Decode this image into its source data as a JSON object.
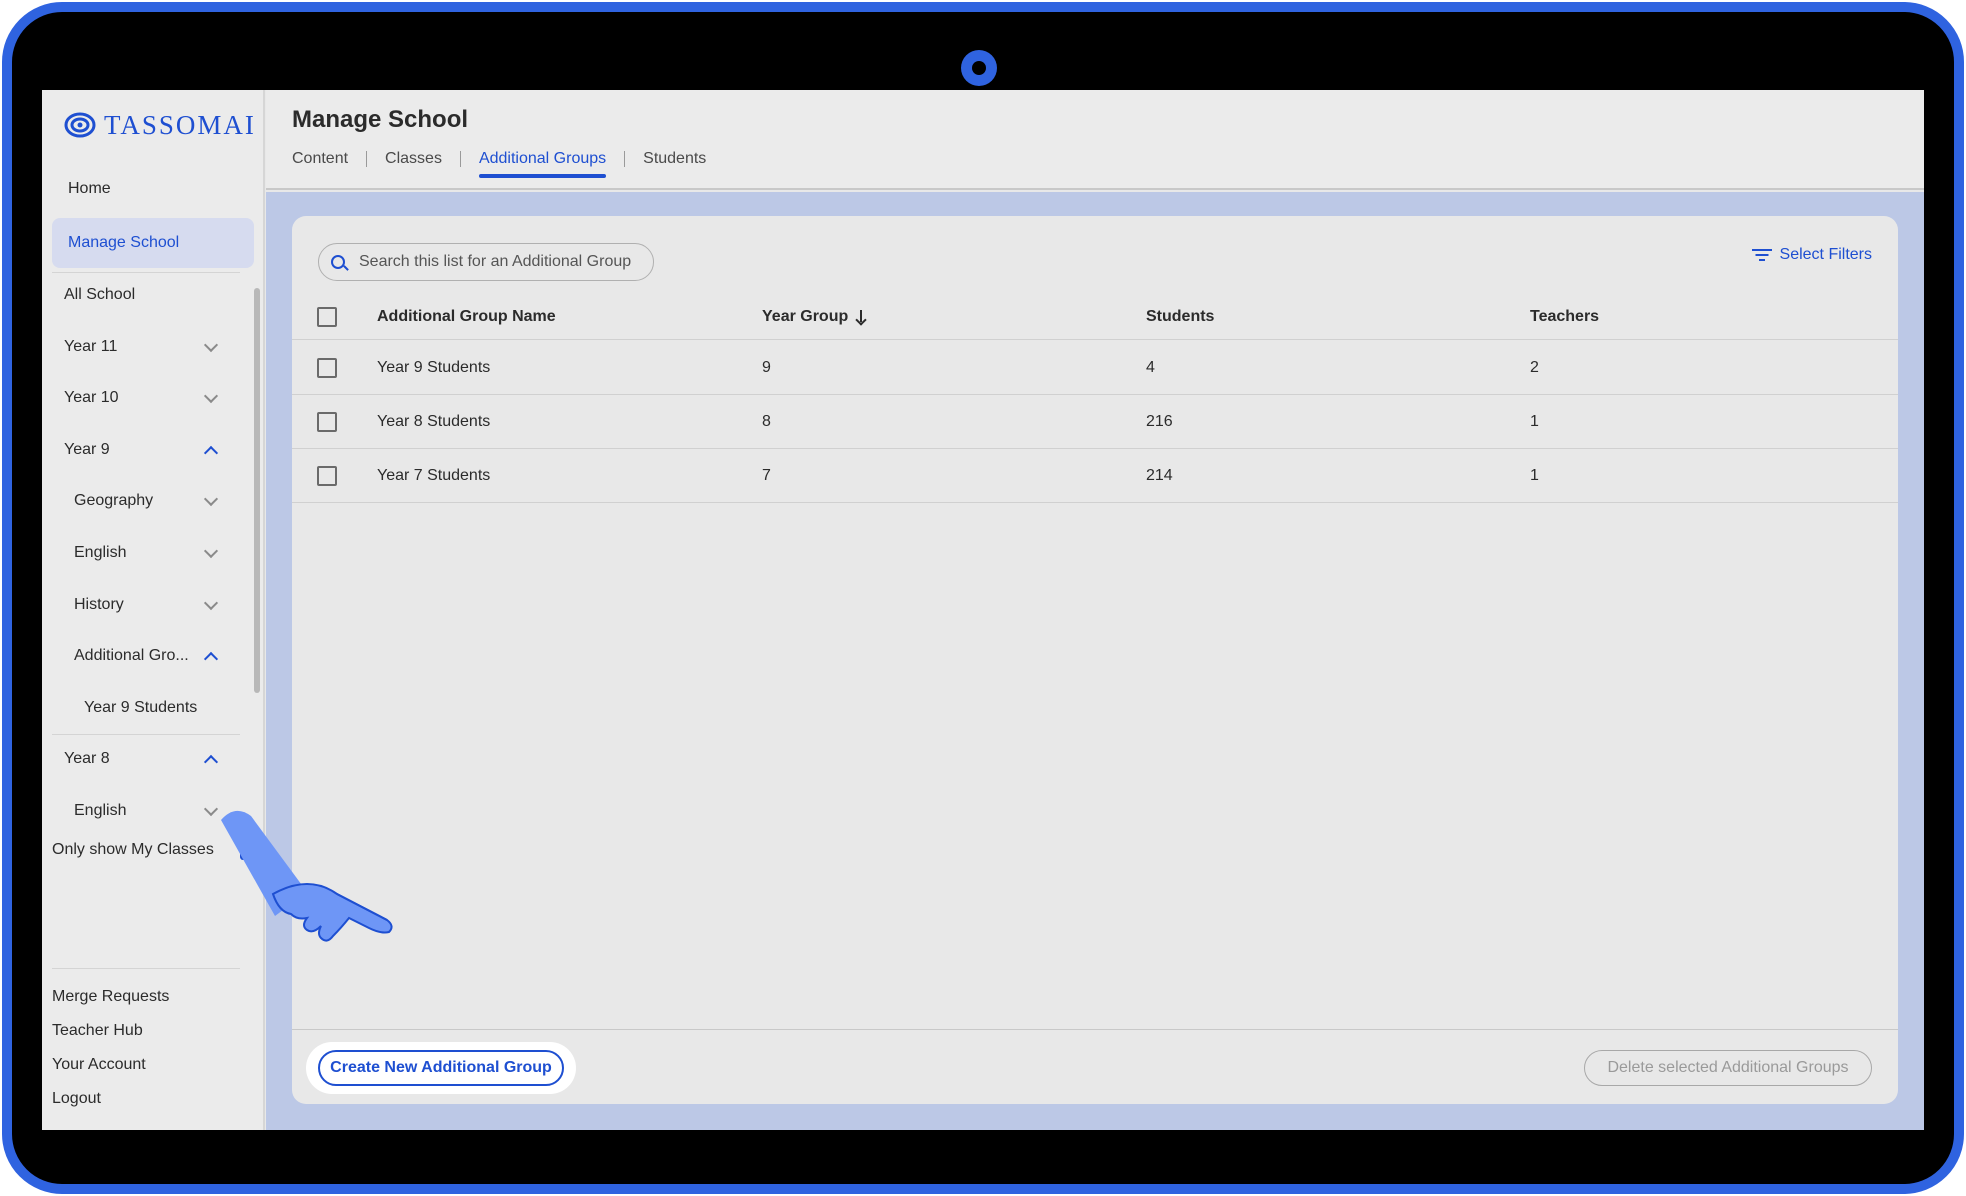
{
  "app": {
    "brand": "TASSOMAI"
  },
  "sidebar": {
    "home": "Home",
    "manage_school": "Manage School",
    "tree": [
      {
        "label": "All School",
        "indent": 0,
        "chevron": "none"
      },
      {
        "label": "Year 11",
        "indent": 0,
        "chevron": "down"
      },
      {
        "label": "Year 10",
        "indent": 0,
        "chevron": "down"
      },
      {
        "label": "Year 9",
        "indent": 0,
        "chevron": "up"
      },
      {
        "label": "Geography",
        "indent": 1,
        "chevron": "down"
      },
      {
        "label": "English",
        "indent": 1,
        "chevron": "down"
      },
      {
        "label": "History",
        "indent": 1,
        "chevron": "down"
      },
      {
        "label": "Additional Gro...",
        "indent": 1,
        "chevron": "up"
      },
      {
        "label": "Year 9 Students",
        "indent": 2,
        "chevron": "none"
      },
      {
        "label": "Year 8",
        "indent": 0,
        "chevron": "up"
      },
      {
        "label": "English",
        "indent": 1,
        "chevron": "down"
      }
    ],
    "only_show_label": "Only show My Classes",
    "only_show_checked": true,
    "bottom_links": [
      "Merge Requests",
      "Teacher Hub",
      "Your Account",
      "Logout"
    ]
  },
  "header": {
    "title": "Manage School",
    "tabs": [
      {
        "label": "Content",
        "active": false
      },
      {
        "label": "Classes",
        "active": false
      },
      {
        "label": "Additional Groups",
        "active": true
      },
      {
        "label": "Students",
        "active": false
      }
    ]
  },
  "toolbar": {
    "search_placeholder": "Search this list for an Additional Group",
    "filters_label": "Select Filters"
  },
  "table": {
    "columns": [
      "Additional Group Name",
      "Year Group",
      "Students",
      "Teachers"
    ],
    "sort_column": "Year Group",
    "rows": [
      {
        "name": "Year 9 Students",
        "year": "9",
        "students": "4",
        "teachers": "2"
      },
      {
        "name": "Year 8 Students",
        "year": "8",
        "students": "216",
        "teachers": "1"
      },
      {
        "name": "Year 7 Students",
        "year": "7",
        "students": "214",
        "teachers": "1"
      }
    ]
  },
  "footer": {
    "create_label": "Create New Additional Group",
    "delete_label": "Delete selected Additional Groups"
  },
  "colors": {
    "accent": "#1e4fd1",
    "frame": "#2f63e0",
    "content_bg": "#bcc8e6"
  }
}
